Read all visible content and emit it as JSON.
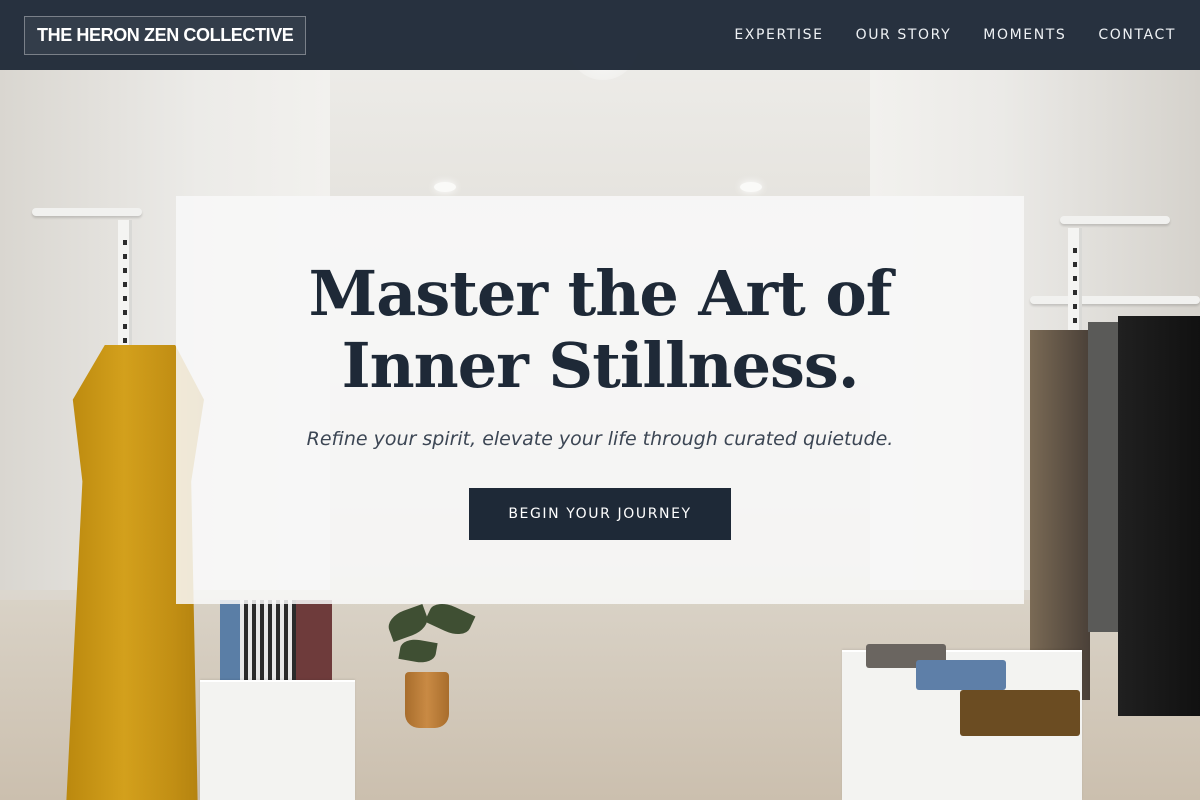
{
  "header": {
    "brand": "THE HERON ZEN COLLECTIVE",
    "nav": [
      {
        "label": "EXPERTISE"
      },
      {
        "label": "OUR STORY"
      },
      {
        "label": "MOMENTS"
      },
      {
        "label": "CONTACT"
      }
    ]
  },
  "hero": {
    "title_line1": "Master the Art of",
    "title_line2": "Inner Stillness.",
    "subtitle": "Refine your spirit, elevate your life through curated quietude.",
    "cta_label": "BEGIN YOUR JOURNEY"
  },
  "colors": {
    "header_bg": "#1e2937",
    "accent": "#1e2937",
    "card_bg": "#f8f8f8"
  }
}
